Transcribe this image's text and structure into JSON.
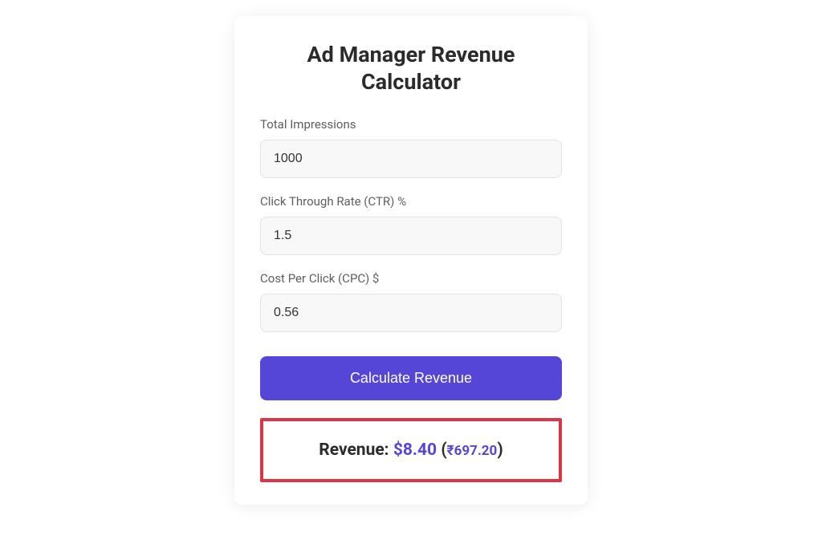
{
  "title": "Ad Manager Revenue Calculator",
  "fields": {
    "impressions": {
      "label": "Total Impressions",
      "value": "1000"
    },
    "ctr": {
      "label": "Click Through Rate (CTR) %",
      "value": "1.5"
    },
    "cpc": {
      "label": "Cost Per Click (CPC) $",
      "value": "0.56"
    }
  },
  "button": {
    "label": "Calculate Revenue"
  },
  "result": {
    "label": "Revenue: ",
    "usd": "$8.40",
    "paren_open": " (",
    "inr": "₹697.20",
    "paren_close": ")"
  },
  "colors": {
    "accent": "#5646d8",
    "highlight_border": "#dc3545"
  }
}
